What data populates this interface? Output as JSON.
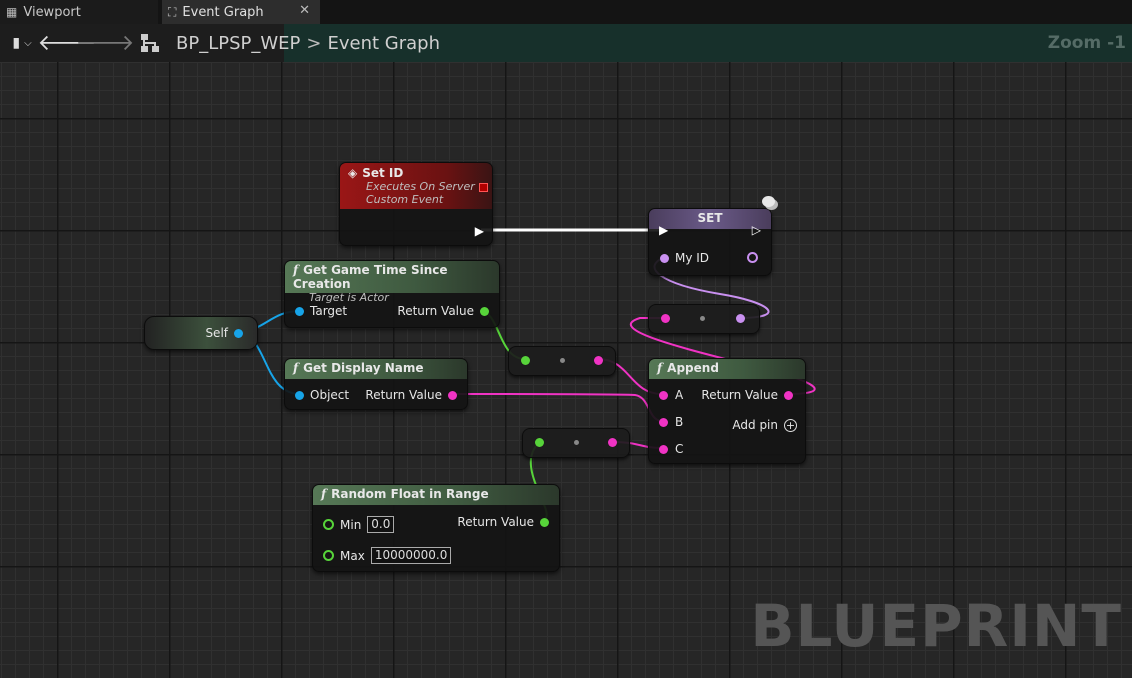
{
  "tabs": [
    {
      "label": "Viewport",
      "icon": "viewport-icon"
    },
    {
      "label": "Event Graph",
      "icon": "graph-icon"
    }
  ],
  "breadcrumb": {
    "blueprint": "BP_LPSP_WEP",
    "separator": ">",
    "graph": "Event Graph"
  },
  "zoom": "Zoom -1",
  "watermark": "BLUEPRINT",
  "nodes": {
    "set_id": {
      "title": "Set ID",
      "subtitle1": "Executes On Server",
      "subtitle2": "Custom Event"
    },
    "set": {
      "title": "SET",
      "var": "My ID"
    },
    "game_time": {
      "title": "Get Game Time Since Creation",
      "subtitle": "Target is Actor",
      "in": "Target",
      "out": "Return Value"
    },
    "self": {
      "label": "Self"
    },
    "display_name": {
      "title": "Get Display Name",
      "in": "Object",
      "out": "Return Value"
    },
    "append": {
      "title": "Append",
      "a": "A",
      "b": "B",
      "c": "C",
      "out": "Return Value",
      "add": "Add pin"
    },
    "random": {
      "title": "Random Float in Range",
      "min_label": "Min",
      "min": "0.0",
      "max_label": "Max",
      "max": "10000000.0",
      "out": "Return Value"
    }
  },
  "colors": {
    "exec": "#ffffff",
    "string": "#f033c4",
    "float": "#57d43a",
    "object": "#17a4e8",
    "name": "#c990f0",
    "event_header": "#8a1818",
    "function_header": "#3f5a40"
  }
}
